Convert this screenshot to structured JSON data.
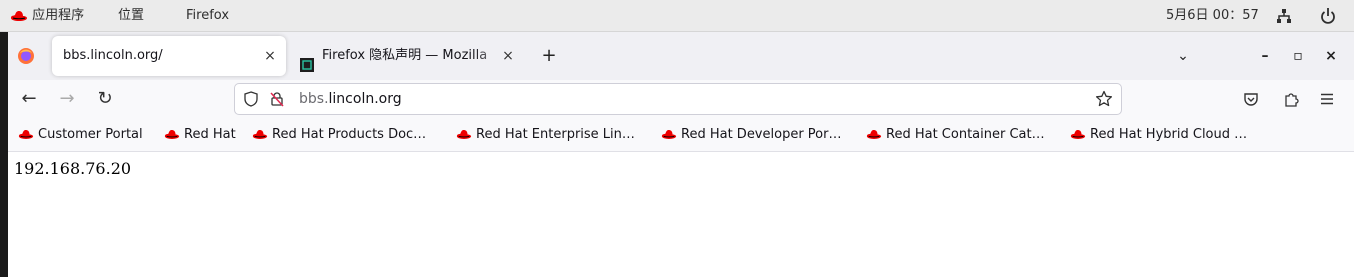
{
  "topbar": {
    "apps_label": "应用程序",
    "places_label": "位置",
    "active_app": "Firefox",
    "clock": "5月6日 00：57",
    "icons": [
      "redhat-icon",
      "network-icon",
      "power-icon"
    ]
  },
  "tabs": [
    {
      "title": "bbs.lincoln.org/",
      "close": "×",
      "active": true
    },
    {
      "title": "Firefox 隐私声明 — Mozilla",
      "close": "×",
      "active": false
    }
  ],
  "new_tab_label": "+",
  "window_controls": {
    "list": "⌄",
    "minimize": "–",
    "maximize": "▫",
    "close": "×"
  },
  "nav": {
    "back": "←",
    "forward": "→",
    "reload": "↻"
  },
  "url": {
    "prefix": "bbs.",
    "domain": "lincoln.org"
  },
  "bookmarks": [
    "Customer Portal",
    "Red Hat",
    "Red Hat Products Doc…",
    "Red Hat Enterprise Lin…",
    "Red Hat Developer Por…",
    "Red Hat Container Cat…",
    "Red Hat Hybrid Cloud …"
  ],
  "content": {
    "text": "192.168.76.20"
  },
  "colors": {
    "redhat": "#ee0000",
    "topbar_bg": "#ebebeb",
    "tabstrip_bg": "#f0f0f4"
  }
}
